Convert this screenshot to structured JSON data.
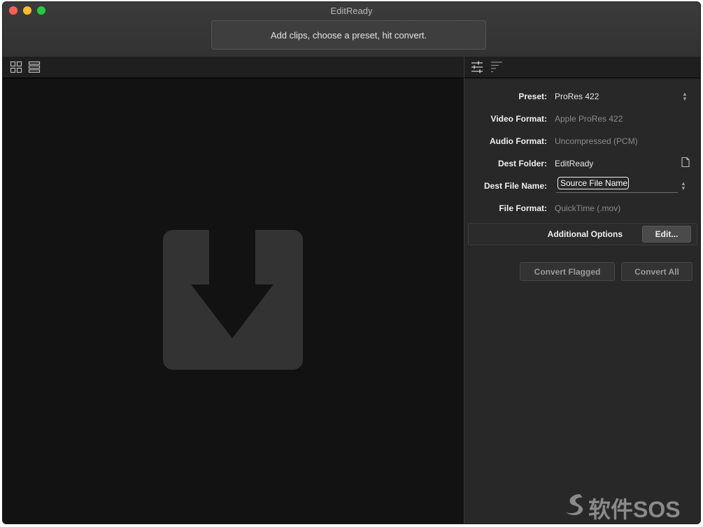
{
  "window": {
    "title": "EditReady",
    "status_message": "Add clips, choose a preset, hit convert."
  },
  "left_toolbar": {
    "icons": [
      "grid-view-icon",
      "list-view-icon"
    ]
  },
  "right_toolbar": {
    "icons": [
      "settings-sliders-icon",
      "sort-icon"
    ]
  },
  "settings": {
    "preset": {
      "label": "Preset:",
      "value": "ProRes 422"
    },
    "video_format": {
      "label": "Video Format:",
      "value": "Apple ProRes 422"
    },
    "audio_format": {
      "label": "Audio Format:",
      "value": "Uncompressed (PCM)"
    },
    "dest_folder": {
      "label": "Dest Folder:",
      "value": "EditReady"
    },
    "dest_file_name": {
      "label": "Dest File Name:",
      "value": "Source File Name"
    },
    "file_format": {
      "label": "File Format:",
      "value": "QuickTime (.mov)"
    }
  },
  "additional_options": {
    "label": "Additional Options",
    "edit_button": "Edit..."
  },
  "actions": {
    "convert_flagged": "Convert Flagged",
    "convert_all": "Convert All"
  },
  "drop_zone": {
    "icon": "download-arrow-icon"
  },
  "watermark": {
    "text": "软件SOS",
    "icon": "watermark-logo-icon"
  },
  "colors": {
    "window_bg": "#2a2a2a",
    "left_pane_bg": "#121212",
    "right_pane_bg": "#282828",
    "close": "#fe5f57",
    "minimize": "#febc2e",
    "maximize": "#28c840"
  }
}
